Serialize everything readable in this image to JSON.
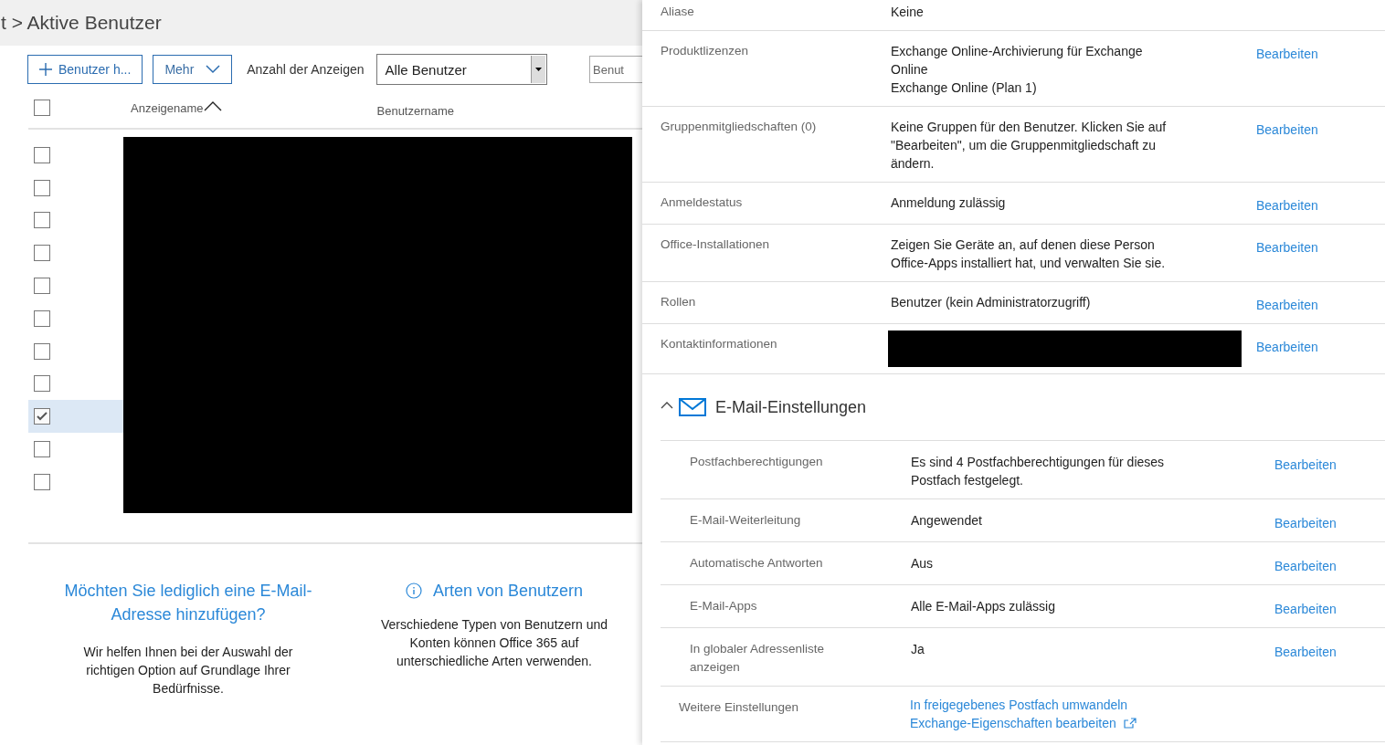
{
  "breadcrumb": "t > Aktive Benutzer",
  "toolbar": {
    "add_button": "Benutzer h...",
    "more_button": "Mehr",
    "view_label": "Anzahl der Anzeigen",
    "view_select": "Alle Benutzer",
    "search_field": "Benut"
  },
  "table": {
    "select_all_checked": false,
    "columns": [
      "Anzeigename",
      "Benutzername"
    ],
    "rows": [
      {
        "checked": false,
        "selected": false
      },
      {
        "checked": false,
        "selected": false
      },
      {
        "checked": false,
        "selected": false
      },
      {
        "checked": false,
        "selected": false
      },
      {
        "checked": false,
        "selected": false
      },
      {
        "checked": false,
        "selected": false
      },
      {
        "checked": false,
        "selected": false
      },
      {
        "checked": false,
        "selected": false
      },
      {
        "checked": true,
        "selected": true
      },
      {
        "checked": false,
        "selected": false
      },
      {
        "checked": false,
        "selected": false
      }
    ]
  },
  "promos": [
    {
      "kind": "plain",
      "title": "Möchten Sie lediglich eine E-Mail-Adresse hinzufügen?",
      "text": "Wir helfen Ihnen bei der Auswahl der richtigen Option auf Grundlage Ihrer Bedürfnisse."
    },
    {
      "kind": "info",
      "title": "Arten von Benutzern",
      "text": "Verschiedene Typen von Benutzern und Konten können Office 365 auf unterschiedliche Arten verwenden."
    }
  ],
  "details": {
    "rows": [
      {
        "label": "Aliase",
        "kind": "text",
        "lines": [
          "Keine"
        ]
      },
      {
        "label": "Produktlizenzen",
        "kind": "text",
        "lines": [
          "Exchange Online-Archivierung für Exchange Online",
          "Exchange Online (Plan 1)"
        ],
        "action": "Bearbeiten"
      },
      {
        "label": "Gruppenmitgliedschaften (0)",
        "kind": "text",
        "lines": [
          "Keine Gruppen für den Benutzer. Klicken Sie auf \"Bearbeiten\", um die Gruppenmitgliedschaft zu ändern."
        ],
        "action": "Bearbeiten"
      },
      {
        "label": "Anmeldestatus",
        "kind": "text",
        "lines": [
          "Anmeldung zulässig"
        ],
        "action": "Bearbeiten"
      },
      {
        "label": "Office-Installationen",
        "kind": "text",
        "lines": [
          "Zeigen Sie Geräte an, auf denen diese Person Office-Apps installiert hat, und verwalten Sie sie."
        ],
        "action": "Bearbeiten"
      },
      {
        "label": "Rollen",
        "kind": "text",
        "lines": [
          "Benutzer (kein Administratorzugriff)"
        ],
        "action": "Bearbeiten"
      },
      {
        "label": "Kontaktinformationen",
        "kind": "redacted",
        "action": "Bearbeiten"
      }
    ],
    "email_section": {
      "title": "E-Mail-Einstellungen",
      "expanded": true,
      "rows": [
        {
          "label": "Postfachberechtigungen",
          "value": "Es sind 4 Postfachberechtigungen für dieses Postfach festgelegt.",
          "action": "Bearbeiten"
        },
        {
          "label": "E-Mail-Weiterleitung",
          "value": "Angewendet",
          "action": "Bearbeiten"
        },
        {
          "label": "Automatische Antworten",
          "value": "Aus",
          "action": "Bearbeiten"
        },
        {
          "label": "E-Mail-Apps",
          "value": "Alle E-Mail-Apps zulässig",
          "action": "Bearbeiten"
        },
        {
          "label": "In globaler Adressenliste anzeigen",
          "value": "Ja",
          "action": "Bearbeiten"
        }
      ]
    },
    "more_settings": {
      "label": "Weitere Einstellungen",
      "links": [
        {
          "text": "In freigegebenes Postfach umwandeln",
          "external": false
        },
        {
          "text": "Exchange-Eigenschaften bearbeiten",
          "external": true
        }
      ]
    }
  }
}
